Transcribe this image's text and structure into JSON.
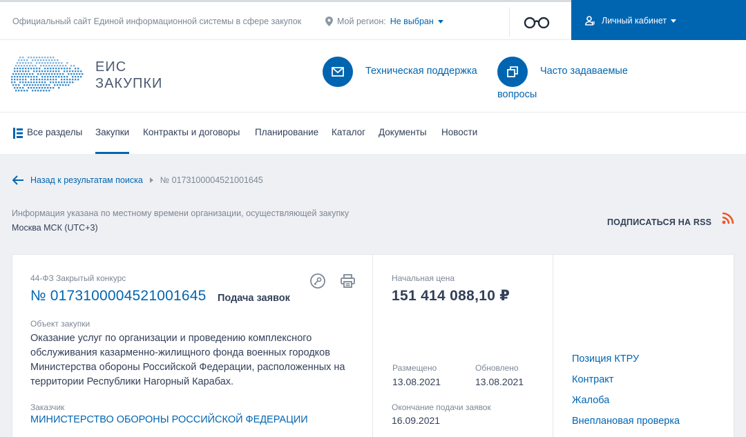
{
  "topbar": {
    "site_note": "Официальный сайт Единой информационной системы в сфере закупок",
    "region_label": "Мой регион:",
    "region_value": "Не выбран",
    "cabinet_label": "Личный кабинет"
  },
  "header": {
    "logo_line1": "ЕИС",
    "logo_line2": "ЗАКУПКИ",
    "support_label": "Техническая поддержка",
    "faq_line1": "Часто задаваемые",
    "faq_line2": "вопросы"
  },
  "nav": {
    "items": [
      "Все разделы",
      "Закупки",
      "Контракты и договоры",
      "Планирование",
      "Каталог",
      "Документы",
      "Новости"
    ],
    "active": "Закупки"
  },
  "breadcrumb": {
    "back_label": "Назад к результатам поиска",
    "current": "№ 0173100004521001645"
  },
  "timezone": {
    "note": "Информация указана по местному времени организации, осуществляющей закупку",
    "value": "Москва МСК (UTC+3)"
  },
  "rss_label": "ПОДПИСАТЬСЯ НА RSS",
  "card": {
    "law_type": "44-ФЗ Закрытый конкурс",
    "reg_number": "№ 0173100004521001645",
    "stage": "Подача заявок",
    "object_label": "Объект закупки",
    "object_text": "Оказание услуг по организации и проведению комплексного обслуживания казарменно-жилищного фонда военных городков Министерства обороны Российской Федерации, расположенных на территории Республики Нагорный Карабах.",
    "customer_label": "Заказчик",
    "customer_value": "МИНИСТЕРСТВО ОБОРОНЫ РОССИЙСКОЙ ФЕДЕРАЦИИ",
    "price_label": "Начальная цена",
    "price_value": "151 414 088,10 ₽",
    "posted_label": "Размещено",
    "posted_value": "13.08.2021",
    "updated_label": "Обновлено",
    "updated_value": "13.08.2021",
    "deadline_label": "Окончание подачи заявок",
    "deadline_value": "16.09.2021",
    "side_links": [
      "Позиция КТРУ",
      "Контракт",
      "Жалоба",
      "Внеплановая проверка"
    ]
  },
  "colors": {
    "brand_blue": "#0065b1",
    "rss_orange": "#e8572a",
    "text_dark": "#334059",
    "text_muted": "#7c8796"
  }
}
